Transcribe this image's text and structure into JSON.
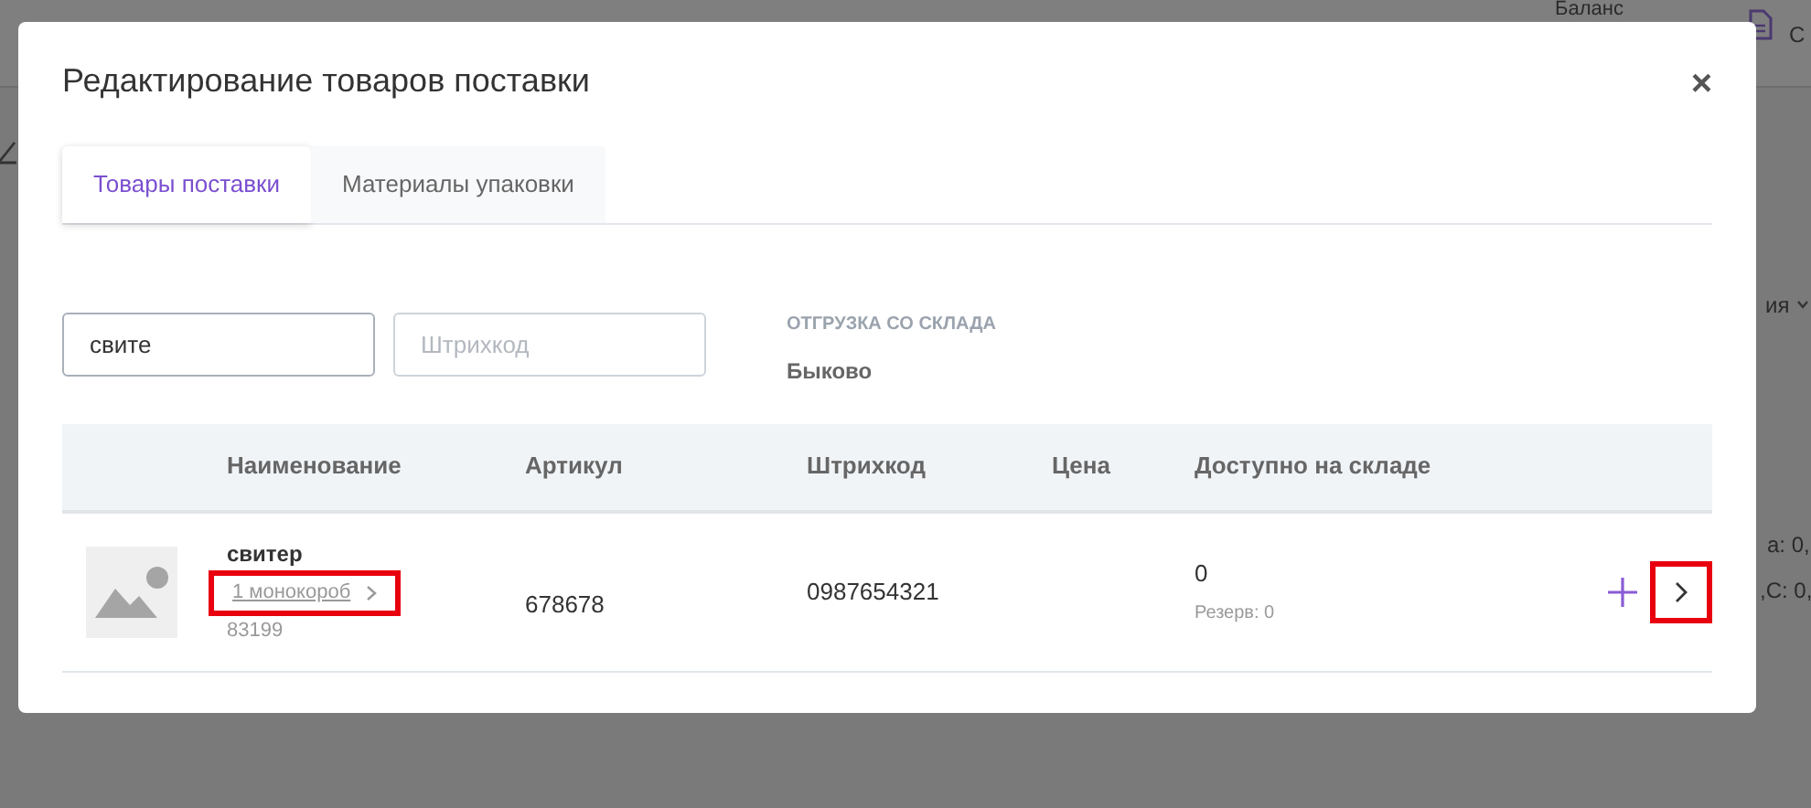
{
  "background": {
    "texts": [
      {
        "kind": "balance",
        "text": "Баланс"
      },
      {
        "kind": "doc",
        "text": "С"
      },
      {
        "kind": "sort",
        "text": "ия"
      },
      {
        "kind": "line1",
        "text": "а: 0,"
      },
      {
        "kind": "line2",
        "text": ",С: 0,"
      }
    ]
  },
  "modal": {
    "title": "Редактирование товаров поставки",
    "close": "×",
    "tabs": [
      {
        "label": "Товары поставки",
        "selected": true
      },
      {
        "label": "Материалы упаковки",
        "selected": false
      }
    ],
    "search": {
      "value": "свите"
    },
    "barcode": {
      "placeholder": "Штрихкод"
    },
    "warehouse": {
      "label": "ОТГРУЗКА СО СКЛАДА",
      "value": "Быково"
    },
    "table": {
      "columns": [
        "Наименование",
        "Артикул",
        "Штрихкод",
        "Цена",
        "Доступно на складе"
      ],
      "rows": [
        {
          "name": "свитер",
          "boxes": {
            "text": "1 монокороб",
            "highlighted": true
          },
          "code": "83199",
          "article": "678678",
          "barcode": "0987654321",
          "available": "0",
          "reserve": "Резерв: 0",
          "next_highlighted": true
        }
      ]
    }
  }
}
